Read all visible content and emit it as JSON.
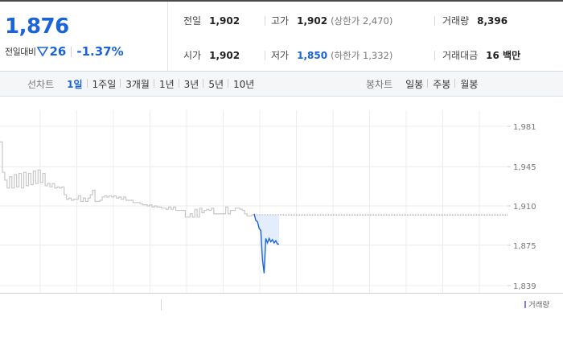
{
  "summary": {
    "price": "1,876",
    "change_label": "전일대비",
    "change_value": "26",
    "change_rate": "-1.37%",
    "prev_close_label": "전일",
    "prev_close": "1,902",
    "open_label": "시가",
    "open": "1,902",
    "high_label": "고가",
    "high": "1,902",
    "upper_limit": "(상한가 2,470)",
    "low_label": "저가",
    "low": "1,850",
    "lower_limit": "(하한가 1,332)",
    "volume_label": "거래량",
    "volume": "8,396",
    "amount_label": "거래대금",
    "amount": "16 백만"
  },
  "period_bar": {
    "line_title": "선차트",
    "line_items": [
      "1일",
      "1주일",
      "3개월",
      "1년",
      "3년",
      "5년",
      "10년"
    ],
    "active_item": "1일",
    "candle_title": "봉차트",
    "candle_items": [
      "일봉",
      "주봉",
      "월봉"
    ]
  },
  "chart_data": {
    "type": "line",
    "title": "",
    "xlabel": "",
    "ylabel": "",
    "ylim": [
      1832,
      1990
    ],
    "y_ticks": [
      1981,
      1945,
      1910,
      1875,
      1839
    ],
    "y_tick_labels": [
      "1,981",
      "1,945",
      "1,910",
      "1,875",
      "1,839"
    ],
    "reference_value": 1902,
    "grid": true,
    "series": [
      {
        "role": "previous",
        "color": "#c8c8c8",
        "values": [
          1967,
          1940,
          1933,
          1926,
          1936,
          1926,
          1938,
          1927,
          1939,
          1926,
          1940,
          1928,
          1939,
          1929,
          1941,
          1930,
          1942,
          1931,
          1939,
          1928,
          1930,
          1927,
          1930,
          1926,
          1927,
          1926,
          1927,
          1920,
          1916,
          1917,
          1915,
          1916,
          1916,
          1919,
          1914,
          1917,
          1914,
          1917,
          1920,
          1924,
          1914,
          1914,
          1915,
          1918,
          1919,
          1918,
          1919,
          1918,
          1919,
          1917,
          1918,
          1916,
          1918,
          1915,
          1915,
          1915,
          1913,
          1913,
          1913,
          1912,
          1911,
          1911,
          1910,
          1911,
          1909,
          1910,
          1909,
          1909,
          1908,
          1908,
          1907,
          1909,
          1907,
          1909,
          1906,
          1906,
          1906,
          1906,
          1900,
          1900,
          1903,
          1900,
          1907,
          1900,
          1908,
          1904,
          1906,
          1907,
          1906,
          1908,
          1903,
          1903,
          1903,
          1903,
          1903,
          1909,
          1903,
          1906,
          1906,
          1908,
          1908,
          1907,
          1906,
          1903,
          1901,
          1901,
          1902,
          1902
        ]
      },
      {
        "role": "today",
        "color": "#1a63d8",
        "values": [
          1903,
          1897,
          1896,
          1890,
          1888,
          1862,
          1850,
          1881,
          1877,
          1881,
          1878,
          1880,
          1877,
          1879,
          1876,
          1876
        ]
      }
    ],
    "legend": [
      "거래량"
    ],
    "legend_color": "#8e7cc3"
  }
}
